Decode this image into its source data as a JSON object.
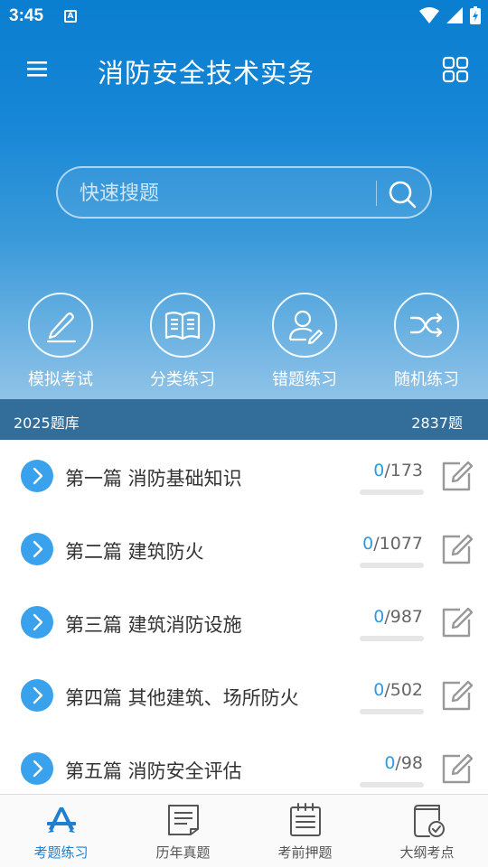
{
  "status": {
    "time": "3:45",
    "notif_icon": "a-icon"
  },
  "appbar": {
    "title": "消防安全技术实务",
    "menu_icon": "menu-icon",
    "grid_icon": "grid-icon"
  },
  "search": {
    "placeholder": "快速搜题",
    "icon": "search-icon"
  },
  "quick": [
    {
      "label": "模拟考试",
      "icon": "pen-icon"
    },
    {
      "label": "分类练习",
      "icon": "book-icon"
    },
    {
      "label": "错题练习",
      "icon": "user-edit-icon"
    },
    {
      "label": "随机练习",
      "icon": "shuffle-icon"
    }
  ],
  "bank": {
    "name": "2025题库",
    "count": "2837题"
  },
  "chapters": [
    {
      "title": "第一篇 消防基础知识",
      "done": "0",
      "total": "/173",
      "progress": 0
    },
    {
      "title": "第二篇 建筑防火",
      "done": "0",
      "total": "/1077",
      "progress": 0
    },
    {
      "title": "第三篇 建筑消防设施",
      "done": "0",
      "total": "/987",
      "progress": 0
    },
    {
      "title": "第四篇 其他建筑、场所防火",
      "done": "0",
      "total": "/502",
      "progress": 0
    },
    {
      "title": "第五篇 消防安全评估",
      "done": "0",
      "total": "/98",
      "progress": 0
    }
  ],
  "tabs": [
    {
      "label": "考题练习",
      "icon": "app-store-icon",
      "active": true
    },
    {
      "label": "历年真题",
      "icon": "document-icon",
      "active": false
    },
    {
      "label": "考前押题",
      "icon": "notepad-icon",
      "active": false
    },
    {
      "label": "大纲考点",
      "icon": "outline-check-icon",
      "active": false
    }
  ],
  "colors": {
    "primary": "#1686d6",
    "accent": "#3aa2ec",
    "bank_bar": "#336d99",
    "tab_active": "#1f7fd0"
  }
}
